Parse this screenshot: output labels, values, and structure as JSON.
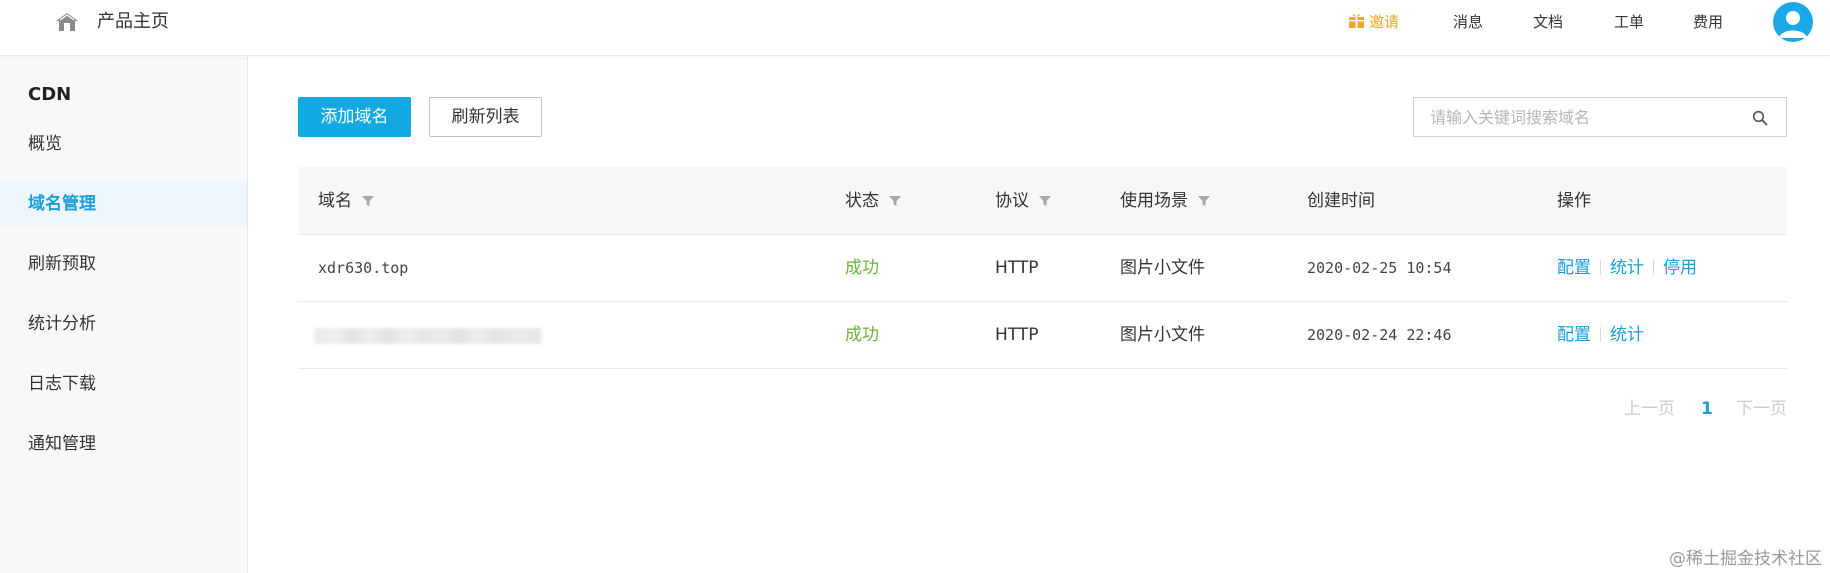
{
  "header": {
    "title": "产品主页",
    "nav": {
      "invite": "邀请",
      "messages": "消息",
      "docs": "文档",
      "tickets": "工单",
      "billing": "费用"
    },
    "invite_color": "#f5a623"
  },
  "sidebar": {
    "title": "CDN",
    "items": [
      {
        "label": "概览",
        "active": false
      },
      {
        "label": "域名管理",
        "active": true
      },
      {
        "label": "刷新预取",
        "active": false
      },
      {
        "label": "统计分析",
        "active": false
      },
      {
        "label": "日志下载",
        "active": false
      },
      {
        "label": "通知管理",
        "active": false
      }
    ]
  },
  "toolbar": {
    "add_label": "添加域名",
    "refresh_label": "刷新列表",
    "search_placeholder": "请输入关键词搜索域名",
    "search_value": ""
  },
  "table": {
    "columns": [
      "域名",
      "状态",
      "协议",
      "使用场景",
      "创建时间",
      "操作"
    ],
    "rows": [
      {
        "domain": "xdr630.top",
        "status": "成功",
        "protocol": "HTTP",
        "scenario": "图片小文件",
        "created": "2020-02-25 10:54",
        "actions": [
          "配置",
          "统计",
          "停用"
        ]
      },
      {
        "domain": "",
        "domain_redacted": true,
        "status": "成功",
        "protocol": "HTTP",
        "scenario": "图片小文件",
        "created": "2020-02-24 22:46",
        "actions": [
          "配置",
          "统计"
        ]
      }
    ]
  },
  "pagination": {
    "prev": "上一页",
    "current": "1",
    "next": "下一页"
  },
  "watermark": "@稀土掘金技术社区",
  "colors": {
    "primary": "#12a8e2",
    "link": "#1a9fd9",
    "success": "#6cb33e",
    "disabled": "#cccccc"
  }
}
